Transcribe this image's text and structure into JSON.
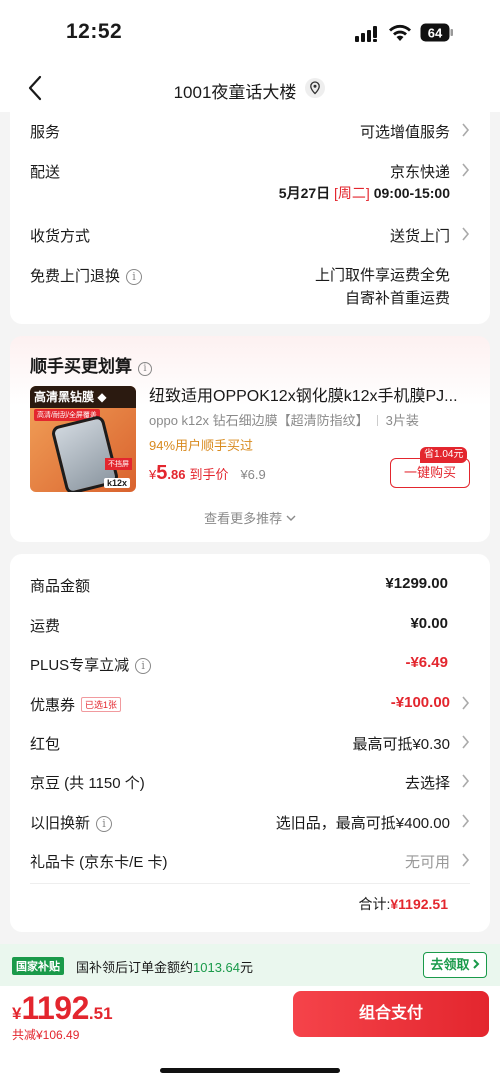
{
  "status_bar": {
    "time": "12:52",
    "battery": "64"
  },
  "nav": {
    "title": "1001夜童话大楼",
    "back_icon": "chevron-left-icon",
    "location_icon": "location-pin-icon"
  },
  "delivery": {
    "service_label": "服务",
    "service_value": "可选增值服务",
    "shipping_label": "配送",
    "shipping_value": "京东快递",
    "shipping_date": "5月27日",
    "shipping_weekday": "[周二]",
    "shipping_time": "09:00-15:00",
    "receive_label": "收货方式",
    "receive_value": "送货上门",
    "return_label": "免费上门退换",
    "return_value_line1": "上门取件享运费全免",
    "return_value_line2": "自寄补首重运费"
  },
  "addon": {
    "title": "顺手买更划算",
    "product": {
      "image_head": "高清黑钻膜",
      "image_tag": "高清/耐刮/全屏覆盖",
      "image_badge": "不挡屏",
      "image_model": "k12x",
      "name": "纽致适用OPPOK12x钢化膜k12x手机膜PJ...",
      "spec": "oppo k12x 钻石细边膜【超清防指纹】",
      "count": "3片装",
      "rate": "94%用户顺手买过",
      "price_currency": "¥",
      "price_int": "5",
      "price_dec": ".86",
      "price_suffix": "到手价",
      "old_price": "¥6.9",
      "save_tag": "省1.04元",
      "buy_label": "一键购买"
    },
    "more_label": "查看更多推荐"
  },
  "summary": {
    "rows": [
      {
        "label": "商品金额",
        "value": "¥1299.00"
      },
      {
        "label": "运费",
        "value": "¥0.00"
      },
      {
        "label": "PLUS专享立减",
        "value": "-¥6.49"
      },
      {
        "label": "优惠券",
        "tag": "已选1张",
        "value": "-¥100.00"
      },
      {
        "label": "红包",
        "value": "最高可抵¥0.30"
      },
      {
        "label": "京豆 (共 1150 个)",
        "value": "去选择"
      },
      {
        "label": "以旧换新",
        "value": "选旧品，最高可抵¥400.00"
      },
      {
        "label": "礼品卡 (京东卡/E 卡)",
        "value": "无可用"
      }
    ],
    "total_label": "合计:",
    "total_value": "¥1192.51"
  },
  "subsidy": {
    "badge": "国家补贴",
    "text": "国补领后订单金额约",
    "amount": "1013.64",
    "unit": "元",
    "claim_label": "去领取"
  },
  "bottom": {
    "currency": "¥",
    "price_int": "1192",
    "price_dec": ".51",
    "reduce_text": "共减¥106.49",
    "pay_label": "组合支付"
  },
  "colors": {
    "accent_red": "#e3262e",
    "green": "#1a9a4a",
    "orange": "#d88a1e"
  }
}
